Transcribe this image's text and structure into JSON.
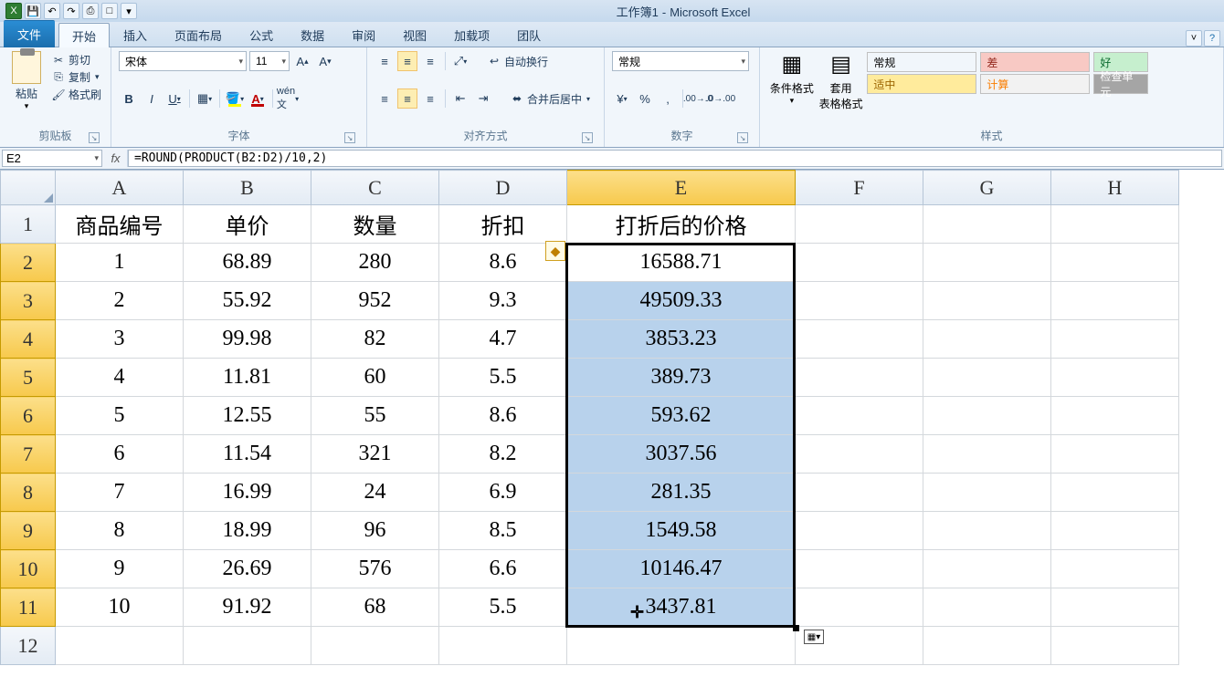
{
  "window": {
    "title": "工作簿1",
    "app": "Microsoft Excel"
  },
  "tabs": {
    "file": "文件",
    "home": "开始",
    "insert": "插入",
    "layout": "页面布局",
    "formulas": "公式",
    "data": "数据",
    "review": "审阅",
    "view": "视图",
    "addins": "加载项",
    "team": "团队"
  },
  "ribbon": {
    "clipboard": {
      "paste": "粘贴",
      "cut": "剪切",
      "copy": "复制",
      "painter": "格式刷",
      "label": "剪贴板"
    },
    "font": {
      "name": "宋体",
      "size": "11",
      "label": "字体"
    },
    "align": {
      "wrap": "自动换行",
      "merge": "合并后居中",
      "label": "对齐方式"
    },
    "number": {
      "format": "常规",
      "label": "数字"
    },
    "styles": {
      "cond": "条件格式",
      "table": "套用\n表格格式",
      "s1": "常规",
      "s2": "差",
      "s3": "好",
      "s4": "适中",
      "s5": "计算",
      "s6": "检查单元",
      "label": "样式"
    }
  },
  "formula": {
    "cell": "E2",
    "text": "=ROUND(PRODUCT(B2:D2)/10,2)"
  },
  "columns": [
    "A",
    "B",
    "C",
    "D",
    "E",
    "F",
    "G",
    "H"
  ],
  "rows_hdr": [
    "1",
    "2",
    "3",
    "4",
    "5",
    "6",
    "7",
    "8",
    "9",
    "10",
    "11",
    "12"
  ],
  "headers": {
    "A": "商品编号",
    "B": "单价",
    "C": "数量",
    "D": "折扣",
    "E": "打折后的价格"
  },
  "data": [
    {
      "A": "1",
      "B": "68.89",
      "C": "280",
      "D": "8.6",
      "E": "16588.71"
    },
    {
      "A": "2",
      "B": "55.92",
      "C": "952",
      "D": "9.3",
      "E": "49509.33"
    },
    {
      "A": "3",
      "B": "99.98",
      "C": "82",
      "D": "4.7",
      "E": "3853.23"
    },
    {
      "A": "4",
      "B": "11.81",
      "C": "60",
      "D": "5.5",
      "E": "389.73"
    },
    {
      "A": "5",
      "B": "12.55",
      "C": "55",
      "D": "8.6",
      "E": "593.62"
    },
    {
      "A": "6",
      "B": "11.54",
      "C": "321",
      "D": "8.2",
      "E": "3037.56"
    },
    {
      "A": "7",
      "B": "16.99",
      "C": "24",
      "D": "6.9",
      "E": "281.35"
    },
    {
      "A": "8",
      "B": "18.99",
      "C": "96",
      "D": "8.5",
      "E": "1549.58"
    },
    {
      "A": "9",
      "B": "26.69",
      "C": "576",
      "D": "6.6",
      "E": "10146.47"
    },
    {
      "A": "10",
      "B": "91.92",
      "C": "68",
      "D": "5.5",
      "E": "3437.81"
    }
  ]
}
